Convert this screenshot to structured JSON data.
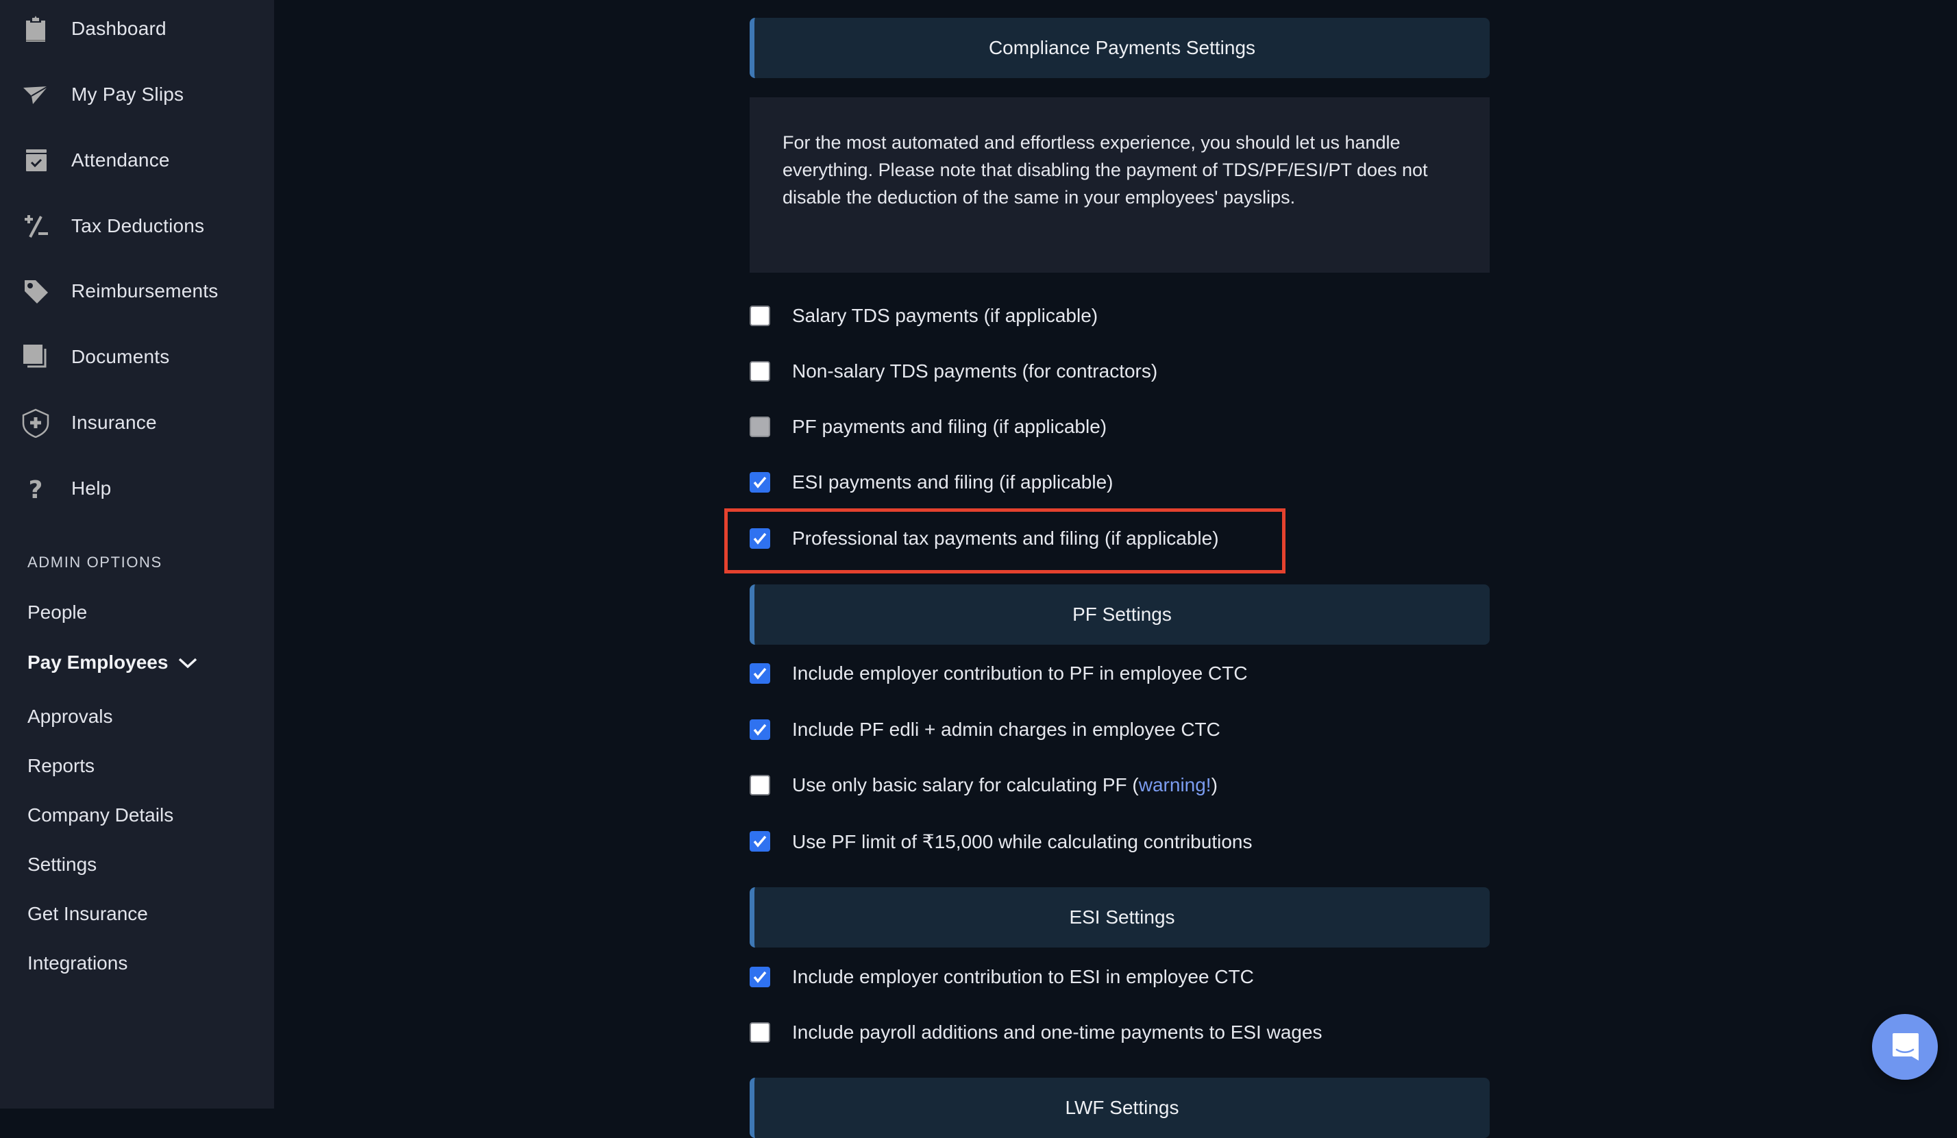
{
  "sidebar": {
    "items": [
      {
        "label": "Dashboard",
        "icon": "clipboard-icon"
      },
      {
        "label": "My Pay Slips",
        "icon": "paper-plane-icon"
      },
      {
        "label": "Attendance",
        "icon": "calendar-check-icon"
      },
      {
        "label": "Tax Deductions",
        "icon": "plus-minus-icon"
      },
      {
        "label": "Reimbursements",
        "icon": "tag-icon"
      },
      {
        "label": "Documents",
        "icon": "documents-icon"
      },
      {
        "label": "Insurance",
        "icon": "shield-plus-icon"
      },
      {
        "label": "Help",
        "icon": "question-icon"
      }
    ],
    "admin_section_label": "ADMIN OPTIONS",
    "admin_items": [
      {
        "label": "People"
      },
      {
        "label": "Pay Employees",
        "expanded": true
      },
      {
        "label": "Approvals"
      },
      {
        "label": "Reports"
      },
      {
        "label": "Company Details"
      },
      {
        "label": "Settings"
      },
      {
        "label": "Get Insurance"
      },
      {
        "label": "Integrations"
      }
    ]
  },
  "main": {
    "compliance": {
      "title": "Compliance Payments Settings",
      "info": "For the most automated and effortless experience, you should let us handle everything. Please note that disabling the payment of TDS/PF/ESI/PT does not disable the deduction of the same in your employees' payslips.",
      "options": [
        {
          "label": "Salary TDS payments (if applicable)",
          "state": "unchecked"
        },
        {
          "label": "Non-salary TDS payments (for contractors)",
          "state": "unchecked"
        },
        {
          "label": "PF payments and filing (if applicable)",
          "state": "disabled"
        },
        {
          "label": "ESI payments and filing (if applicable)",
          "state": "checked"
        },
        {
          "label": "Professional tax payments and filing (if applicable)",
          "state": "checked",
          "highlighted": true
        }
      ]
    },
    "pf": {
      "title": "PF Settings",
      "options": [
        {
          "label": "Include employer contribution to PF in employee CTC",
          "state": "checked"
        },
        {
          "label": "Include PF edli + admin charges in employee CTC",
          "state": "checked"
        },
        {
          "label_prefix": "Use only basic salary for calculating PF (",
          "link": "warning!",
          "label_suffix": ")",
          "state": "unchecked"
        },
        {
          "label": "Use PF limit of ₹15,000 while calculating contributions",
          "state": "checked"
        }
      ]
    },
    "esi": {
      "title": "ESI Settings",
      "options": [
        {
          "label": "Include employer contribution to ESI in employee CTC",
          "state": "checked"
        },
        {
          "label": "Include payroll additions and one-time payments to ESI wages",
          "state": "unchecked"
        }
      ]
    },
    "lwf": {
      "title": "LWF Settings"
    }
  },
  "colors": {
    "accent_blue": "#2f72f0",
    "link": "#7b9cf0",
    "highlight_red": "#e5422e",
    "chat_launcher": "#6f96f0"
  },
  "chat_launcher": {
    "icon": "chat-bubble-icon"
  }
}
